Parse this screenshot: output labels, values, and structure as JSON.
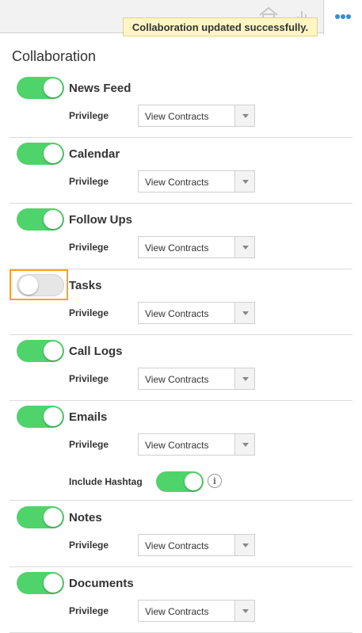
{
  "toast": {
    "message": "Collaboration updated successfully."
  },
  "topbar": {
    "icons": [
      "home-icon",
      "bar-chart-icon",
      "more-dots-icon"
    ],
    "accent": "#2f8de4"
  },
  "section": {
    "title": "Collaboration"
  },
  "colors": {
    "toggle_on": "#4fd36b",
    "toggle_off": "#e6e6e6",
    "focus": "#f5a32b"
  },
  "rows": [
    {
      "label": "News Feed",
      "enabled": true,
      "privilege_label": "Privilege",
      "privilege": "View Contracts"
    },
    {
      "label": "Calendar",
      "enabled": true,
      "privilege_label": "Privilege",
      "privilege": "View Contracts"
    },
    {
      "label": "Follow Ups",
      "enabled": true,
      "privilege_label": "Privilege",
      "privilege": "View Contracts"
    },
    {
      "label": "Tasks",
      "enabled": false,
      "privilege_label": "Privilege",
      "privilege": "View Contracts"
    },
    {
      "label": "Call Logs",
      "enabled": true,
      "privilege_label": "Privilege",
      "privilege": "View Contracts"
    },
    {
      "label": "Emails",
      "enabled": true,
      "privilege_label": "Privilege",
      "privilege": "View Contracts",
      "hashtag_label": "Include Hashtag",
      "hashtag_enabled": true
    },
    {
      "label": "Notes",
      "enabled": true,
      "privilege_label": "Privilege",
      "privilege": "View Contracts"
    },
    {
      "label": "Documents",
      "enabled": true,
      "privilege_label": "Privilege",
      "privilege": "View Contracts"
    }
  ]
}
